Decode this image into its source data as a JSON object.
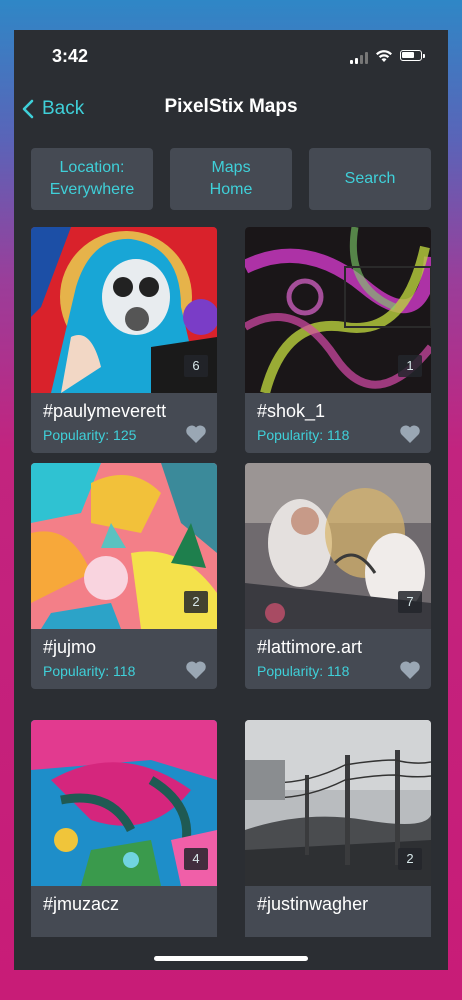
{
  "status_bar": {
    "time": "3:42"
  },
  "nav": {
    "back_label": "Back",
    "title": "PixelStix Maps"
  },
  "filters": [
    {
      "label": "Location:\nEverywhere"
    },
    {
      "label": "Maps\nHome"
    },
    {
      "label": "Search"
    }
  ],
  "cards": [
    {
      "name": "#paulymeverett",
      "popularity": "Popularity: 125",
      "count": "6"
    },
    {
      "name": "#shok_1",
      "popularity": "Popularity: 118",
      "count": "1"
    },
    {
      "name": "#jujmo",
      "popularity": "Popularity: 118",
      "count": "2"
    },
    {
      "name": "#lattimore.art",
      "popularity": "Popularity: 118",
      "count": "7"
    },
    {
      "name": "#jmuzacz",
      "popularity": "",
      "count": "4"
    },
    {
      "name": "#justinwagher",
      "popularity": "",
      "count": "2"
    }
  ],
  "colors": {
    "accent": "#3fd0d9",
    "panel": "#2b2e33",
    "card": "#454a53"
  },
  "icons": [
    "chevron-left-icon",
    "heart-icon",
    "wifi-icon",
    "battery-icon",
    "signal-icon"
  ]
}
